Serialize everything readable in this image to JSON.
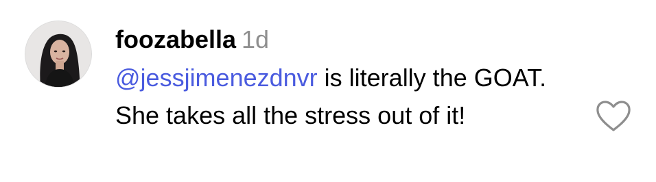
{
  "comment": {
    "author": {
      "username": "foozabella",
      "avatar_icon": "profile-photo"
    },
    "timestamp": "1d",
    "mention": "@jessjimenezdnvr",
    "text": " is literally the GOAT. She takes all the stress out of it!",
    "like_icon": "heart-outline-icon"
  },
  "colors": {
    "mention": "#4a5bdf",
    "timestamp": "#8e8e8e",
    "text": "#000000",
    "heart_stroke": "#8e8e8e"
  }
}
